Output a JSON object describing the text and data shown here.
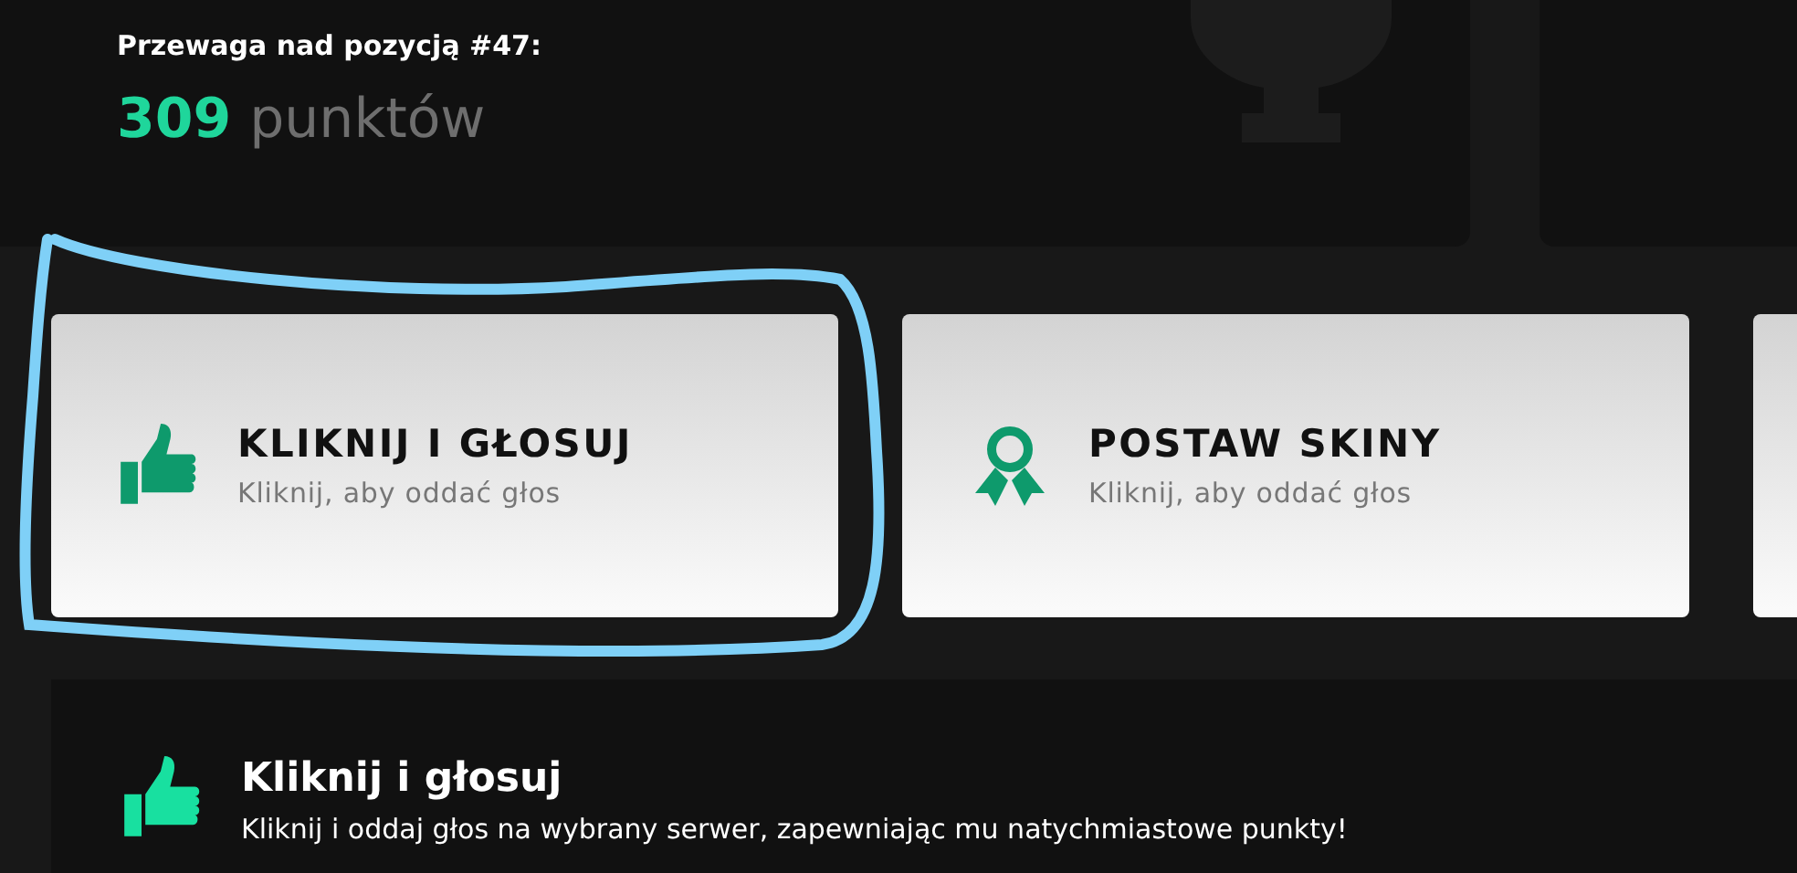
{
  "summary": {
    "label": "Przewaga nad pozycją #47:",
    "points": "309",
    "unit": "punktów"
  },
  "cards": [
    {
      "kind": "thumb",
      "title": "KLIKNIJ I GŁOSUJ",
      "subtitle": "Kliknij, aby oddać głos"
    },
    {
      "kind": "ribbon",
      "title": "POSTAW SKINY",
      "subtitle": "Kliknij, aby oddać głos"
    }
  ],
  "annotation": {
    "kind": "outline"
  },
  "info": {
    "kind": "thumb",
    "title": "Kliknij i głosuj",
    "text": "Kliknij i oddaj głos na wybrany serwer, zapewniając mu natychmiastowe punkty!"
  }
}
